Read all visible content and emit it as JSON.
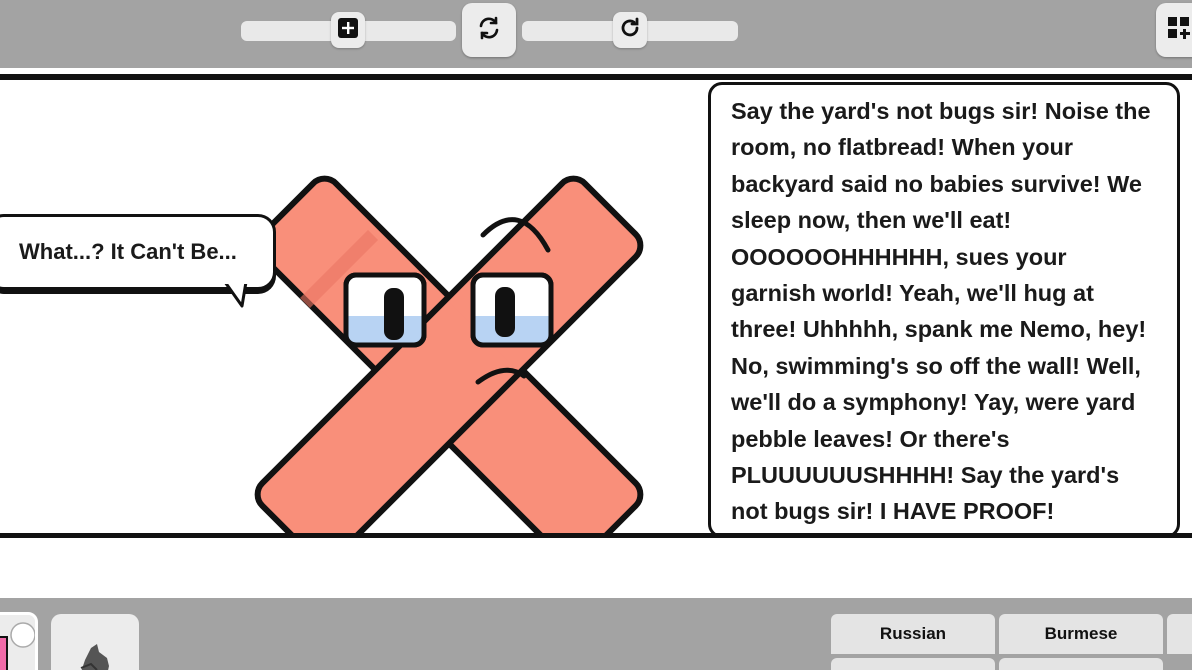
{
  "speech_bubble": {
    "text": "What...? It Can't Be..."
  },
  "lyrics": {
    "lines": [
      "Say the yard's not bugs sir! Noise the",
      "room, no flatbread! When your",
      "backyard said no babies survive! We",
      "sleep now, then we'll eat!",
      "OOOOOOHHHHHH, sues your",
      "garnish world! Yeah, we'll hug at",
      "three! Uhhhhh, spank me Nemo, hey!",
      "No, swimming's so off the wall! Well,",
      "we'll do a symphony! Yay, were yard",
      "pebble leaves! Or there's",
      "PLUUUUUUSHHHH! Say the yard's",
      "not bugs sir! I HAVE PROOF!"
    ]
  },
  "toolbar": {
    "add_icon": "plus-icon",
    "swap_icon": "refresh-cycle-icon",
    "reload_icon": "rotate-clockwise-icon",
    "grid_icon": "grid-add-icon"
  },
  "language_tabs": [
    {
      "label": "Russian"
    },
    {
      "label": "Burmese"
    }
  ],
  "colors": {
    "toolbar_bg": "#a3a3a3",
    "character_fill": "#f98f7a",
    "outline": "#111111"
  }
}
